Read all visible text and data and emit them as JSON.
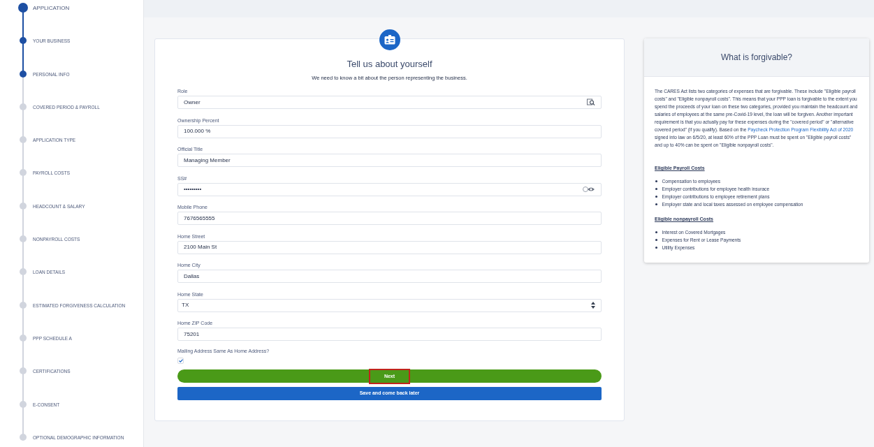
{
  "steps": [
    {
      "label": "APPLICATION",
      "kind": "header",
      "completed": true
    },
    {
      "label": "YOUR BUSINESS",
      "kind": "step",
      "completed": true
    },
    {
      "label": "PERSONAL INFO",
      "kind": "step",
      "completed": true
    },
    {
      "label": "COVERED PERIOD & PAYROLL",
      "kind": "step",
      "completed": false
    },
    {
      "label": "APPLICATION TYPE",
      "kind": "step",
      "completed": false
    },
    {
      "label": "PAYROLL COSTS",
      "kind": "step",
      "completed": false
    },
    {
      "label": "HEADCOUNT & SALARY",
      "kind": "step",
      "completed": false
    },
    {
      "label": "NONPAYROLL COSTS",
      "kind": "step",
      "completed": false
    },
    {
      "label": "LOAN DETAILS",
      "kind": "step",
      "completed": false
    },
    {
      "label": "ESTIMATED FORGIVENESS CALCULATION",
      "kind": "step",
      "completed": false
    },
    {
      "label": "PPP SCHEDULE A",
      "kind": "step",
      "completed": false
    },
    {
      "label": "CERTIFICATIONS",
      "kind": "step",
      "completed": false
    },
    {
      "label": "E-CONSENT",
      "kind": "step",
      "completed": false
    },
    {
      "label": "OPTIONAL DEMOGRAPHIC INFORMATION",
      "kind": "step",
      "completed": false
    }
  ],
  "form": {
    "title": "Tell us about yourself",
    "subtitle": "We need to know a bit about the person representing the business.",
    "fields": [
      {
        "label": "Role",
        "value": "Owner",
        "kind": "lookup"
      },
      {
        "label": "Ownership Percent",
        "value": "100.000 %",
        "kind": "text"
      },
      {
        "label": "Official Title",
        "value": "Managing Member",
        "kind": "text"
      },
      {
        "label": "SS#",
        "value": "•••••••••",
        "kind": "secret"
      },
      {
        "label": "Mobile Phone",
        "value": "7676565555",
        "kind": "text"
      },
      {
        "label": "Home Street",
        "value": "2100 Main St",
        "kind": "text"
      },
      {
        "label": "Home City",
        "value": "Dallas",
        "kind": "text"
      },
      {
        "label": "Home State",
        "value": "TX",
        "kind": "select"
      },
      {
        "label": "Home ZIP Code",
        "value": "75201",
        "kind": "text"
      }
    ],
    "checkbox": {
      "label": "Mailing Address Same As Home Address?",
      "checked": true
    },
    "next_button": {
      "label": "Next",
      "highlighted": true
    },
    "save_button": {
      "label": "Save and come back later"
    }
  },
  "info": {
    "title": "What is forgivable?",
    "paragraph": {
      "before": "The CARES Act lists two categories of expenses that are forgivable. These include \"Eligible payroll costs\" and \"Eligible nonpayroll costs\". This means that your PPP loan is forgivable to the extent you spend the proceeds of your loan on these two categories, provided you maintain the headcount and salaries of employees at the same pre-Covid-19 level, the loan will be forgiven. Another important requirement is that you actually pay for these expenses during the \"covered period\" or \"alternative covered period\" (if you qualify).  Based on the",
      "link": "Paycheck Protection Program Flexibility Act of 2020",
      "after": "signed into law on 6/5/20, at least 60% of the PPP Loan must be spent on \"Eligible payroll costs\" and up to 40% can be spent on \"Eligible nonpayroll costs\"."
    },
    "sections": [
      {
        "heading": "Eligible Payroll Costs",
        "items": [
          "Compensation to employees",
          "Employer contributions for employee health insurace",
          "Employer contributions to employee retirement plans",
          "Employer state and local taxes assessed on employee compensation"
        ]
      },
      {
        "heading": "Eligible nonpayroll Costs",
        "items": [
          "Interest on Covered Mortgages",
          "Expenses for Rent or Lease Payments",
          "Utility Expenses"
        ]
      }
    ]
  }
}
